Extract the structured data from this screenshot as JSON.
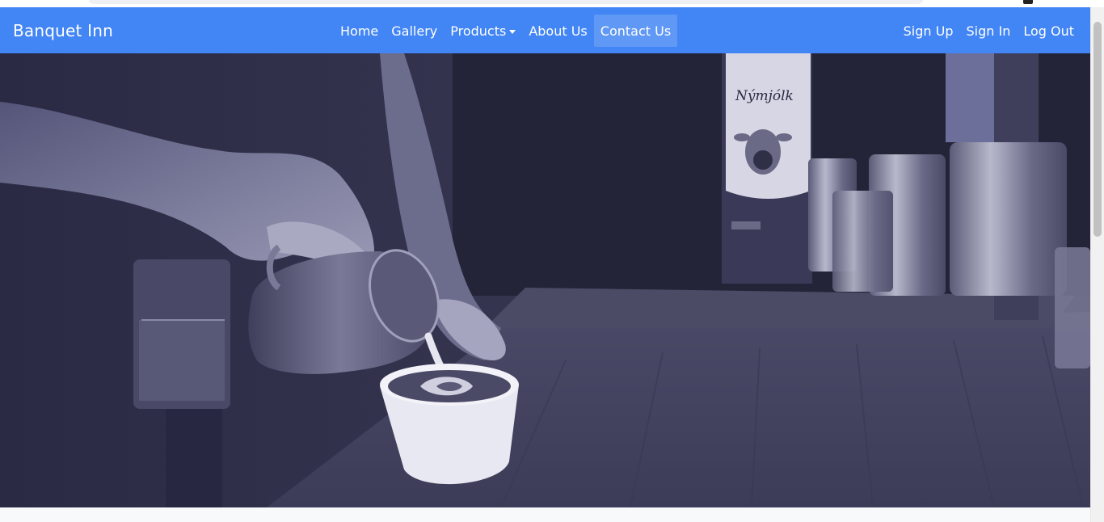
{
  "navbar": {
    "brand": "Banquet Inn",
    "links": [
      {
        "label": "Home"
      },
      {
        "label": "Gallery"
      },
      {
        "label": "Products"
      },
      {
        "label": "About Us"
      },
      {
        "label": "Contact Us"
      }
    ],
    "auth": [
      {
        "label": "Sign Up"
      },
      {
        "label": "Sign In"
      },
      {
        "label": "Log Out"
      }
    ],
    "active": "Contact Us",
    "color": "#4285f4"
  },
  "hero": {
    "image": "latte-art-pour-photo",
    "carton_text": "Nýmjólk",
    "tint": "#2f2f4a"
  },
  "icons": {
    "dropdown": "caret-down-icon"
  }
}
